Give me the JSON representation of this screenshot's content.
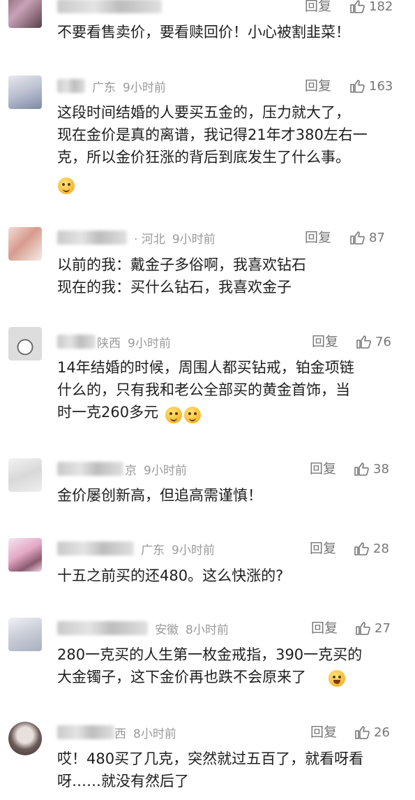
{
  "comments": [
    {
      "location": "",
      "time": "",
      "reply_label": "回复",
      "likes": "182",
      "content": "不要看售卖价，要看赎回价！小心被割韭菜！",
      "emoji": []
    },
    {
      "location": "广东",
      "time": "9小时前",
      "reply_label": "回复",
      "likes": "163",
      "content": "这段时间结婚的人要买五金的，压力就大了，\n现在金价是真的离谱，我记得21年才380左右一\n克，所以金价狂涨的背后到底发生了什么事。",
      "emoji": [
        "thinking-emoji"
      ]
    },
    {
      "location": "· 河北",
      "time": "9小时前",
      "reply_label": "回复",
      "likes": "87",
      "content": "以前的我：戴金子多俗啊，我喜欢钻石\n现在的我：买什么钻石，我喜欢金子",
      "emoji": []
    },
    {
      "location": "陕西",
      "time": "9小时前",
      "reply_label": "回复",
      "likes": "76",
      "content": "14年结婚的时候，周围人都买钻戒，铂金项链\n什么的，只有我和老公全部买的黄金首饰，当\n时一克260多元",
      "emoji": [
        "grimace-emoji",
        "grimace-emoji"
      ]
    },
    {
      "location": "京",
      "time": "9小时前",
      "reply_label": "回复",
      "likes": "38",
      "content": "金价屡创新高，但追高需谨慎！",
      "emoji": []
    },
    {
      "location": "广东",
      "time": "9小时前",
      "reply_label": "回复",
      "likes": "28",
      "content": "十五之前买的还480。这么快涨的?",
      "emoji": []
    },
    {
      "location": "安徽",
      "time": "8小时前",
      "reply_label": "回复",
      "likes": "27",
      "content": "280一克买的人生第一枚金戒指，390一克买的\n大金镯子，这下金价再也跌不会原来了",
      "emoji": [
        "laughing-emoji"
      ]
    },
    {
      "location": "西",
      "time": "8小时前",
      "reply_label": "回复",
      "likes": "26",
      "content": "哎！480买了几克，突然就过五百了，就看呀看\n呀……就没有然后了",
      "emoji": []
    }
  ]
}
